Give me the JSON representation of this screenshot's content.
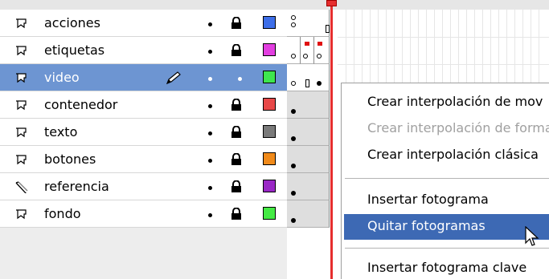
{
  "layers": [
    {
      "name": "acciones",
      "type": "folder-layer",
      "color": "#3d6ee8",
      "selected": false
    },
    {
      "name": "etiquetas",
      "type": "folder-layer",
      "color": "#e23ee0",
      "selected": false
    },
    {
      "name": "video",
      "type": "folder-layer",
      "color": "#3ee64e",
      "selected": true
    },
    {
      "name": "contenedor",
      "type": "folder-layer",
      "color": "#e84848",
      "selected": false
    },
    {
      "name": "texto",
      "type": "folder-layer",
      "color": "#7a7a7a",
      "selected": false
    },
    {
      "name": "botones",
      "type": "folder-layer",
      "color": "#f08a1a",
      "selected": false
    },
    {
      "name": "referencia",
      "type": "guide-layer",
      "color": "#9a28c6",
      "selected": false
    },
    {
      "name": "fondo",
      "type": "folder-layer",
      "color": "#44ea44",
      "selected": false
    }
  ],
  "icons": {
    "layer": "layer-icon",
    "guide": "guide-layer-icon",
    "pencil": "pencil-icon",
    "lock": "lock-icon",
    "eye": "visibility-dot",
    "cursor": "arrow-cursor-icon"
  },
  "context_menu": {
    "items": [
      {
        "label": "Crear interpolación de mov",
        "state": "normal"
      },
      {
        "label": "Crear interpolación de forma",
        "state": "disabled"
      },
      {
        "label": "Crear interpolación clásica",
        "state": "normal"
      },
      {
        "label": "Insertar fotograma",
        "state": "normal"
      },
      {
        "label": "Quitar fotogramas",
        "state": "highlighted"
      },
      {
        "label": "Insertar fotograma clave",
        "state": "normal"
      }
    ]
  },
  "colors": {
    "selection": "#6d95d2",
    "menu_highlight": "#3d69b4",
    "playhead": "#e62e2e"
  }
}
